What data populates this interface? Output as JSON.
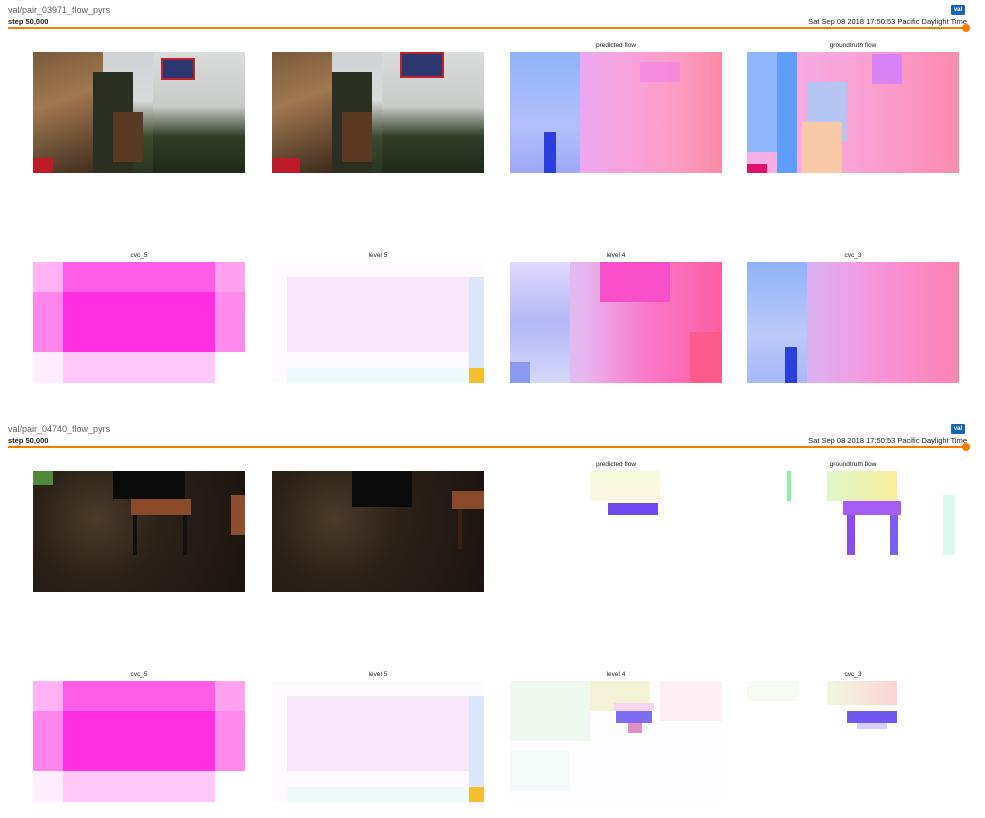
{
  "cards": [
    {
      "title": "val/pair_03971_flow_pyrs",
      "step": "step 50,000",
      "timestamp": "Sat Sep 08 2018 17:50:53 Pacific Daylight Time",
      "badge": "val",
      "labels": [
        "predicted flow",
        "groundtruth flow",
        "cvc_5",
        "level 5",
        "level 4",
        "cvc_3"
      ]
    },
    {
      "title": "val/pair_04740_flow_pyrs",
      "step": "step 50,000",
      "timestamp": "Sat Sep 08 2018 17:50:53 Pacific Daylight Time",
      "badge": "val",
      "labels": [
        "predicted flow",
        "groundtruth flow",
        "cvc_5",
        "level 5",
        "level 4",
        "cvc_3"
      ]
    }
  ]
}
